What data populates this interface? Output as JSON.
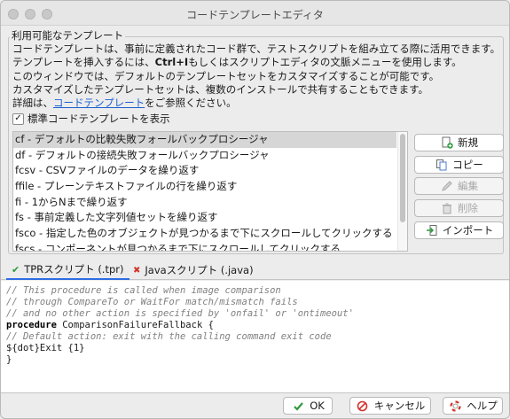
{
  "window": {
    "title": "コードテンプレートエディタ"
  },
  "group": {
    "label": "利用可能なテンプレート"
  },
  "description": {
    "line1": "コードテンプレートは、事前に定義されたコード群で、テストスクリプトを組み立てる際に活用できます。",
    "line2_prefix": "テンプレートを挿入するには、",
    "line2_shortcut": "Ctrl+I",
    "line2_suffix": "もしくはスクリプトエディタの文脈メニューを使用します。",
    "line3": "このウィンドウでは、デフォルトのテンプレートセットをカスタマイズすることが可能です。",
    "line4": "カスタマイズしたテンプレートセットは、複数のインストールで共有することもできます。",
    "line5_prefix": "詳細は、",
    "line5_link": "コードテンプレート",
    "line5_suffix": "をご参照ください。"
  },
  "show_standard": {
    "label": "標準コードテンプレートを表示",
    "checked": true,
    "mark": "✓"
  },
  "templates": [
    {
      "label": "cf - デフォルトの比較失敗フォールバックプロシージャ",
      "selected": true
    },
    {
      "label": "df - デフォルトの接続失敗フォールバックプロシージャ",
      "selected": false
    },
    {
      "label": "fcsv - CSVファイルのデータを繰り返す",
      "selected": false
    },
    {
      "label": "ffile - プレーンテキストファイルの行を繰り返す",
      "selected": false
    },
    {
      "label": "fi - 1からNまで繰り返す",
      "selected": false
    },
    {
      "label": "fs - 事前定義した文字列値セットを繰り返す",
      "selected": false
    },
    {
      "label": "fsco - 指定した色のオブジェクトが見つかるまで下にスクロールしてクリックする",
      "selected": false
    },
    {
      "label": "fscs - コンポーネントが見つかるまで下にスクロールしてクリックする",
      "selected": false
    }
  ],
  "buttons": {
    "new": "新規",
    "copy": "コピー",
    "edit": "編集",
    "delete": "削除",
    "import": "インポート"
  },
  "tabs": [
    {
      "label": "TPRスクリプト (.tpr)",
      "status": "valid",
      "mark": "✔"
    },
    {
      "label": "Javaスクリプト (.java)",
      "status": "invalid",
      "mark": "✖"
    }
  ],
  "editor_lines": [
    {
      "text": "// This procedure is called when image comparison",
      "style": "comment"
    },
    {
      "text": "// through CompareTo or WaitFor match/mismatch fails",
      "style": "comment"
    },
    {
      "text": "// and no other action is specified by 'onfail' or 'ontimeout'",
      "style": "comment"
    },
    {
      "keyword": "procedure",
      "text": " ComparisonFailureFallback {",
      "style": "kw"
    },
    {
      "text": "// Default action: exit with the calling command exit code",
      "style": "comment"
    },
    {
      "text": "${dot}Exit {1}",
      "style": "plain"
    },
    {
      "text": "}",
      "style": "plain"
    }
  ],
  "footer": {
    "ok": "OK",
    "cancel": "キャンセル",
    "help": "ヘルプ"
  },
  "colors": {
    "accent": "#2f6de3",
    "link": "#1a5fd0",
    "ok_green": "#2e9a3e",
    "error_red": "#d0342c"
  }
}
